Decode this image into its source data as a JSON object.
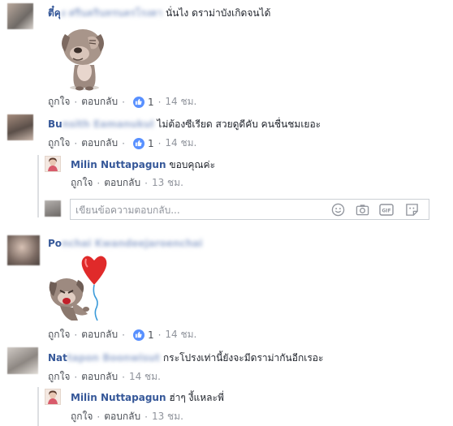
{
  "colors": {
    "name_link": "#365899",
    "text": "#1d2129",
    "meta": "#4b4f56",
    "muted": "#90949c",
    "like": "#5890ff"
  },
  "labels": {
    "like": "ถูกใจ",
    "reply": "ตอบกลับ",
    "separator": "·"
  },
  "comments": [
    {
      "name_visible": "ตี๋คุ",
      "name_blurred": "ง ศรีนครินทรนครโรงตา",
      "text": "นั่นไง ดราม่าบังเกิดจนได้",
      "has_sticker": true,
      "sticker": "bulldog-facepalm-sticker",
      "likes": "1",
      "time": "14 ชม."
    },
    {
      "name_visible": "Bu",
      "name_blurred": "nsith Eamanukul",
      "text": "ไม่ต้องซีเรียด สวยดูดีคับ คนชื่นชมเยอะ",
      "likes": "1",
      "time": "14 ชม.",
      "replies": [
        {
          "name": "Milin Nuttapagun",
          "text": "ขอบคุณค่ะ",
          "time": "13 ชม."
        }
      ],
      "reply_placeholder": "เขียนข้อความตอบกลับ..."
    },
    {
      "name_visible": "Po",
      "name_blurred": "nchai Kwandeejaroenchai",
      "text": "",
      "has_sticker": true,
      "sticker": "bulldog-heart-balloon-sticker",
      "likes": "1",
      "time": "14 ชม."
    },
    {
      "name_visible": "Nat",
      "name_blurred": "tapon Boonwisut",
      "text": "กระโปรงเท่านี้ยังจะมีดราม่ากันอีกเรอะ",
      "time": "14 ชม.",
      "replies": [
        {
          "name": "Milin Nuttapagun",
          "text": "ฮ่าๆ งี้แหละพี่",
          "time": "13 ชม."
        }
      ]
    }
  ],
  "reply_box_icons": [
    "emoji-icon",
    "camera-icon",
    "gif-icon",
    "sticker-icon"
  ]
}
